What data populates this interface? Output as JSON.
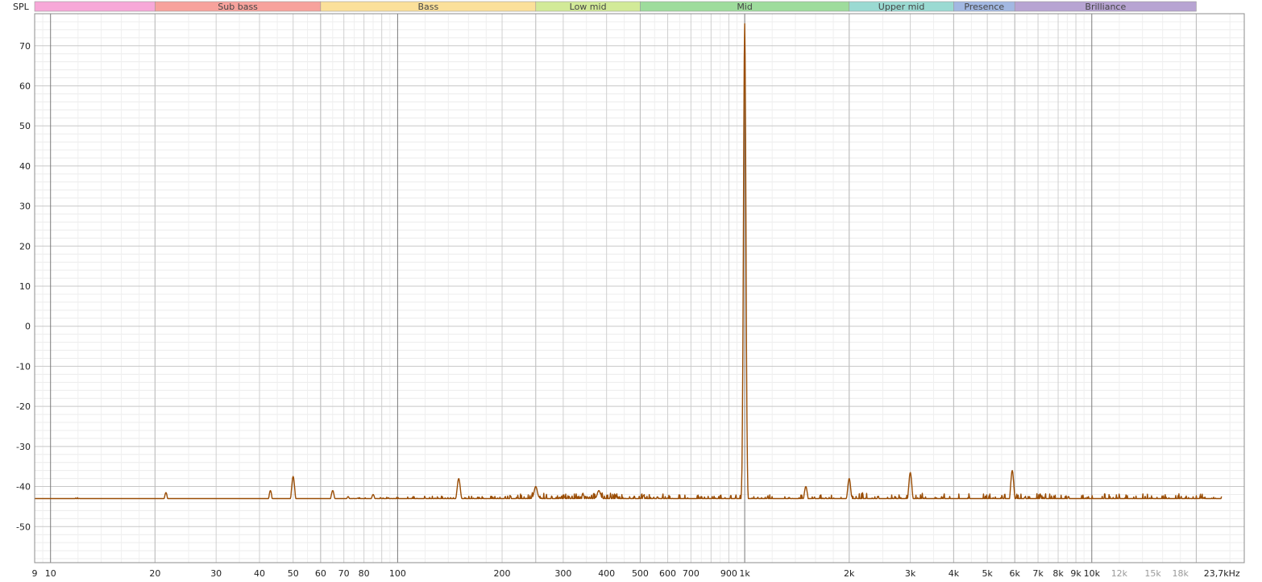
{
  "chart_data": {
    "type": "line",
    "ylabel": "SPL",
    "xlabel": "",
    "x_unit": "kHz",
    "x_scale": "log",
    "xlim": [
      9,
      27500
    ],
    "ylim": [
      -59,
      78
    ],
    "y_ticks": [
      70,
      60,
      50,
      40,
      30,
      20,
      10,
      0,
      -10,
      -20,
      -30,
      -40,
      -50
    ],
    "x_tick_labels": [
      {
        "f": 9,
        "label": "9"
      },
      {
        "f": 10,
        "label": "10"
      },
      {
        "f": 20,
        "label": "20"
      },
      {
        "f": 30,
        "label": "30"
      },
      {
        "f": 40,
        "label": "40"
      },
      {
        "f": 50,
        "label": "50"
      },
      {
        "f": 60,
        "label": "60"
      },
      {
        "f": 70,
        "label": "70"
      },
      {
        "f": 80,
        "label": "80"
      },
      {
        "f": 100,
        "label": "100"
      },
      {
        "f": 200,
        "label": "200"
      },
      {
        "f": 300,
        "label": "300"
      },
      {
        "f": 400,
        "label": "400"
      },
      {
        "f": 500,
        "label": "500"
      },
      {
        "f": 600,
        "label": "600"
      },
      {
        "f": 700,
        "label": "700"
      },
      {
        "f": 900,
        "label": "900"
      },
      {
        "f": 1000,
        "label": "1k"
      },
      {
        "f": 2000,
        "label": "2k"
      },
      {
        "f": 3000,
        "label": "3k"
      },
      {
        "f": 4000,
        "label": "4k"
      },
      {
        "f": 5000,
        "label": "5k"
      },
      {
        "f": 6000,
        "label": "6k"
      },
      {
        "f": 7000,
        "label": "7k"
      },
      {
        "f": 8000,
        "label": "8k"
      },
      {
        "f": 9000,
        "label": "9k"
      },
      {
        "f": 10000,
        "label": "10k"
      },
      {
        "f": 12000,
        "label": "12k",
        "minor": true
      },
      {
        "f": 15000,
        "label": "15k",
        "minor": true
      },
      {
        "f": 18000,
        "label": "18k",
        "minor": true
      },
      {
        "f": 23700,
        "label": "23,7kHz"
      }
    ],
    "bands": [
      {
        "label": "",
        "from": 9,
        "to": 20,
        "color": "#f7a8d8"
      },
      {
        "label": "Sub bass",
        "from": 20,
        "to": 60,
        "color": "#f7a29c"
      },
      {
        "label": "Bass",
        "from": 60,
        "to": 250,
        "color": "#fbe09a"
      },
      {
        "label": "Low mid",
        "from": 250,
        "to": 500,
        "color": "#d2ea98"
      },
      {
        "label": "Mid",
        "from": 500,
        "to": 2000,
        "color": "#9edc9c"
      },
      {
        "label": "Upper mid",
        "from": 2000,
        "to": 4000,
        "color": "#9adad2"
      },
      {
        "label": "Presence",
        "from": 4000,
        "to": 6000,
        "color": "#a2b8e2"
      },
      {
        "label": "Brilliance",
        "from": 6000,
        "to": 20000,
        "color": "#b7a4d2"
      }
    ],
    "series": [
      {
        "color": "#9a4d05",
        "noise_floor": [
          [
            9,
            -45
          ],
          [
            12,
            -44
          ],
          [
            15,
            -44.5
          ],
          [
            20,
            -45
          ],
          [
            30,
            -45
          ],
          [
            40,
            -45.5
          ],
          [
            60,
            -44.5
          ],
          [
            100,
            -44
          ],
          [
            200,
            -44
          ],
          [
            250,
            -43
          ],
          [
            300,
            -43.5
          ],
          [
            400,
            -43
          ],
          [
            500,
            -44
          ],
          [
            700,
            -44.5
          ],
          [
            950,
            -44.5
          ],
          [
            1100,
            -44.5
          ],
          [
            2000,
            -44.5
          ],
          [
            4000,
            -45
          ],
          [
            10000,
            -45
          ],
          [
            22000,
            -45
          ],
          [
            23700,
            -45
          ]
        ],
        "peaks": [
          [
            10,
            -45
          ],
          [
            11.5,
            -43
          ],
          [
            15,
            -43.5
          ],
          [
            21.5,
            -41.5
          ],
          [
            29,
            -43.5
          ],
          [
            43,
            -41
          ],
          [
            50,
            -37.5
          ],
          [
            65,
            -41
          ],
          [
            72,
            -42.5
          ],
          [
            85,
            -42
          ],
          [
            150,
            -38
          ],
          [
            250,
            -40
          ],
          [
            380,
            -41
          ],
          [
            1000,
            75.5
          ],
          [
            1500,
            -40
          ],
          [
            2000,
            -38
          ],
          [
            3000,
            -36.5
          ],
          [
            5900,
            -36
          ]
        ]
      }
    ]
  }
}
